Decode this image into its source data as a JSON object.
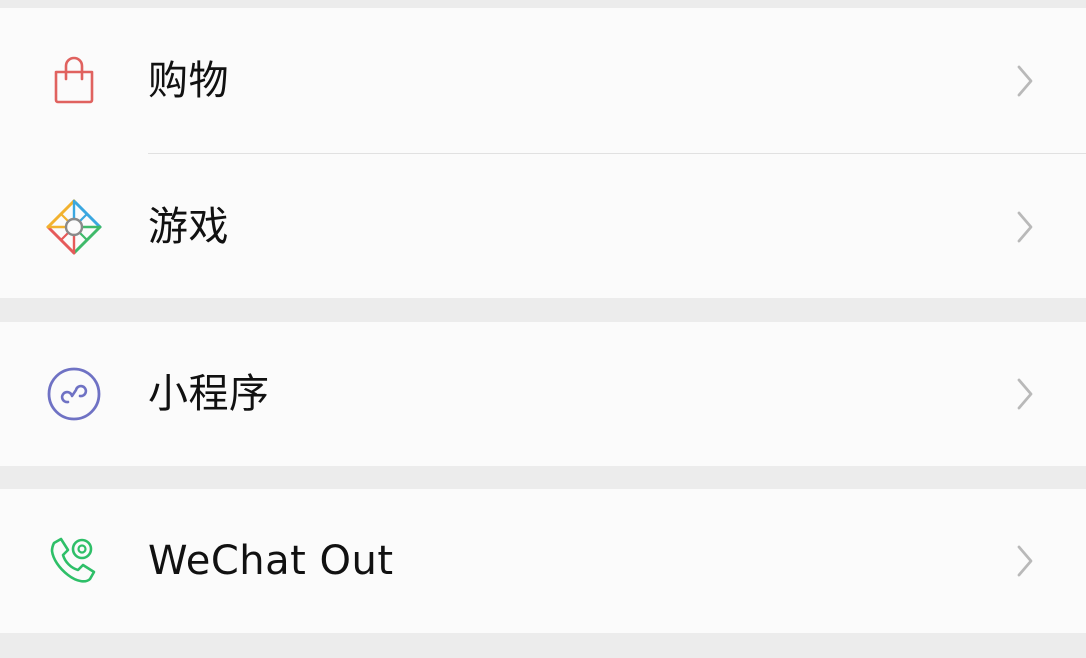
{
  "menu": {
    "shopping": {
      "label": "购物",
      "icon": "shopping-bag-icon",
      "color": "#e0625f"
    },
    "games": {
      "label": "游戏",
      "icon": "games-diamond-icon"
    },
    "mini_programs": {
      "label": "小程序",
      "icon": "mini-program-icon",
      "color": "#6f72c4"
    },
    "wechat_out": {
      "label": "WeChat Out",
      "icon": "phone-icon",
      "color": "#2ebf68"
    },
    "chevron_icon": "chevron-right-icon"
  }
}
